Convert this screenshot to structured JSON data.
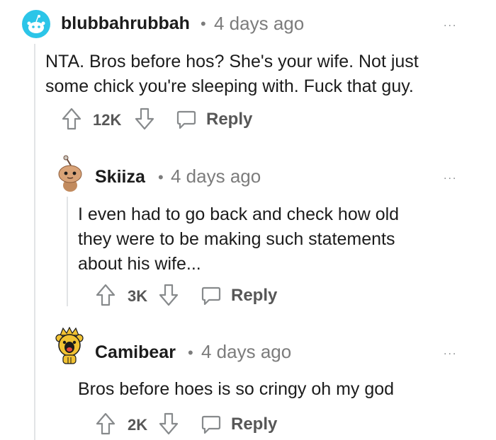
{
  "comments": [
    {
      "username": "blubbahrubbah",
      "separator": "•",
      "time": "4 days ago",
      "more": "...",
      "body": [
        "NTA. Bros before hos? She's your wife. Not just",
        "some chick you're sleeping with. Fuck that guy."
      ],
      "votes": "12K",
      "reply_label": "Reply",
      "avatar_icon": "snoo-avatar-icon"
    },
    {
      "username": "Skiiza",
      "separator": "•",
      "time": "4 days ago",
      "more": "...",
      "body": [
        "I even had to go back and check how old",
        "they were to be making such statements",
        "about his wife..."
      ],
      "votes": "3K",
      "reply_label": "Reply",
      "avatar_icon": "snoo-avatar-icon"
    },
    {
      "username": "Camibear",
      "separator": "•",
      "time": "4 days ago",
      "more": "...",
      "body": [
        "Bros before hoes is so cringy oh my god"
      ],
      "votes": "2K",
      "reply_label": "Reply",
      "avatar_icon": "bear-avatar-icon"
    }
  ],
  "colors": {
    "accent_avatar": "#2cc5e8",
    "text": "#1c1c1c",
    "meta": "#7c7c7c",
    "thread_line": "#e2e4e6"
  }
}
